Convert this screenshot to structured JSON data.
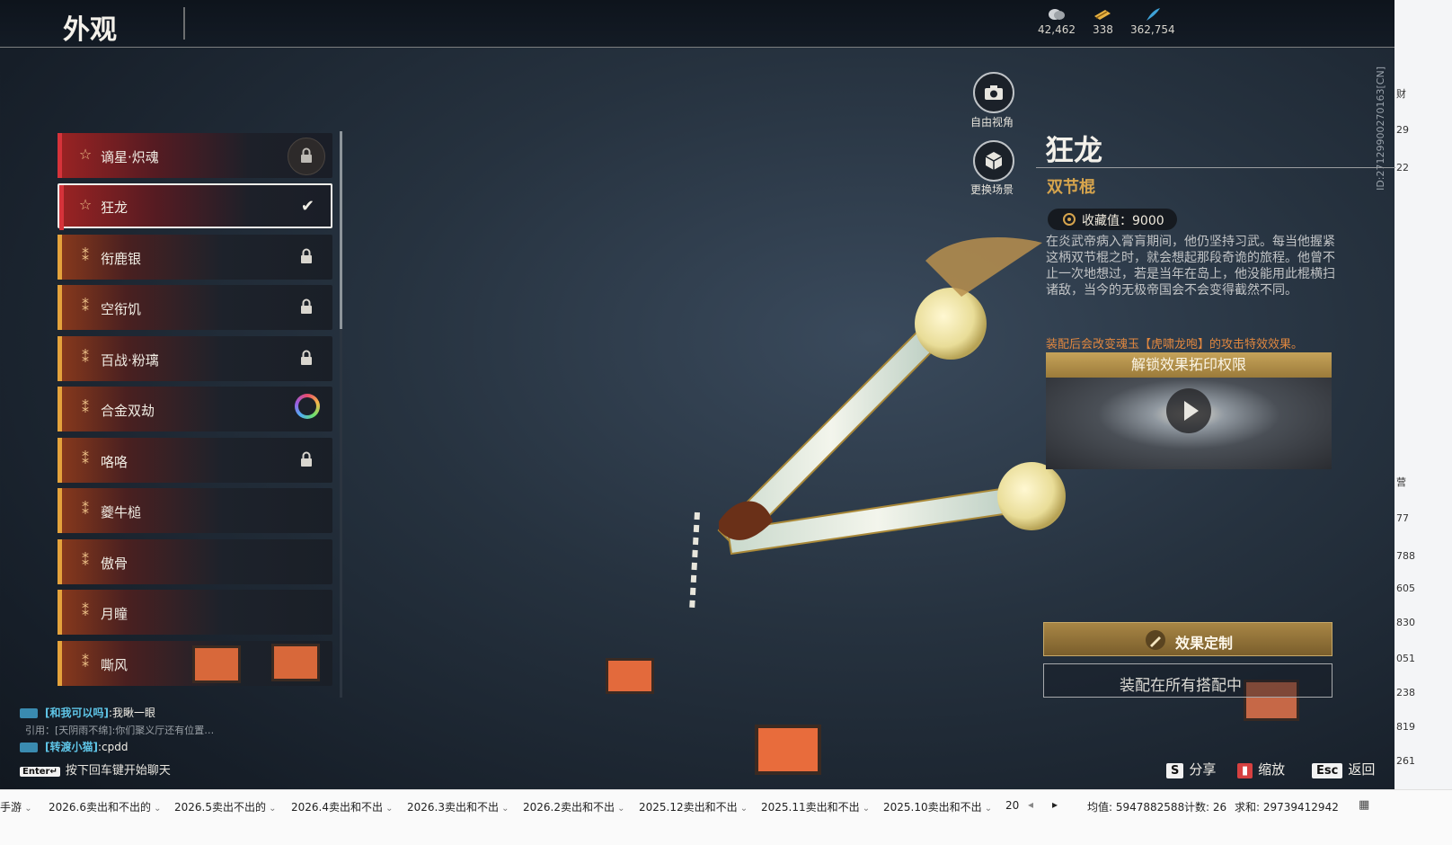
{
  "header": {
    "title": "外观"
  },
  "currencies": [
    {
      "icon": "coin-icon",
      "value": "42,462"
    },
    {
      "icon": "ticket-icon",
      "value": "338"
    },
    {
      "icon": "feather-icon",
      "value": "362,754"
    }
  ],
  "session_id": "ID:27129900270163[CN]",
  "list": {
    "items": [
      {
        "label": "谪星·炽魂",
        "type": "star",
        "status": "locked-big"
      },
      {
        "label": "狂龙",
        "type": "star",
        "status": "selected"
      },
      {
        "label": "衔鹿银",
        "type": "cross",
        "status": "locked"
      },
      {
        "label": "空衔饥",
        "type": "cross",
        "status": "locked"
      },
      {
        "label": "百战·粉璃",
        "type": "cross",
        "status": "locked"
      },
      {
        "label": "合金双劫",
        "type": "cross",
        "status": "ring"
      },
      {
        "label": "咯咯",
        "type": "cross",
        "status": "locked"
      },
      {
        "label": "夔牛槌",
        "type": "cross",
        "status": ""
      },
      {
        "label": "傲骨",
        "type": "cross",
        "status": ""
      },
      {
        "label": "月瞳",
        "type": "cross",
        "status": ""
      },
      {
        "label": "嘶风",
        "type": "cross",
        "status": ""
      }
    ]
  },
  "view_controls": {
    "free_view": "自由视角",
    "change_scene": "更换场景"
  },
  "detail": {
    "name": "狂龙",
    "type": "双节棍",
    "collect_value": "收藏值：9000",
    "description": "在炎武帝病入膏肓期间，他仍坚持习武。每当他握紧这柄双节棍之时，就会想起那段奇诡的旅程。他曾不止一次地想过，若是当年在岛上，他没能用此棍横扫诸敌，当今的无极帝国会不会变得截然不同。",
    "effect_note": "装配后会改变魂玉【虎啸龙咆】的攻击特效效果。",
    "unlock_label": "解锁效果拓印权限",
    "custom_button": "效果定制",
    "equip_button": "装配在所有搭配中"
  },
  "chat": [
    {
      "name": "[和我可以吗]",
      "text": ":我瞅一眼"
    },
    {
      "quote": "引用：[天阴雨不绵]:你们聚义厅还有位置…"
    },
    {
      "name": "[转渡小猫]",
      "text": ":cpdd"
    }
  ],
  "chat_hint": {
    "key": "Enter↵",
    "text": "按下回车键开始聊天"
  },
  "hotkeys": [
    {
      "key": "S",
      "label": "分享"
    },
    {
      "key": "",
      "label": "缩放"
    },
    {
      "key": "Esc",
      "label": "返回"
    }
  ],
  "right_panel_numbers": [
    "财",
    "29",
    "22",
    "营",
    "77",
    "788",
    "605",
    "830",
    "051",
    "238",
    "819",
    "261"
  ],
  "taskbar": {
    "tabs": [
      "手游",
      "2026.6卖出和不出的",
      "2026.5卖出不出的",
      "2026.4卖出和不出",
      "2026.3卖出和不出",
      "2026.2卖出和不出",
      "2025.12卖出和不出",
      "2025.11卖出和不出",
      "2025.10卖出和不出",
      "20"
    ],
    "stats": {
      "avg": "均值: 5947882588",
      "count": "计数: 26",
      "sum": "求和: 29739412942"
    }
  }
}
